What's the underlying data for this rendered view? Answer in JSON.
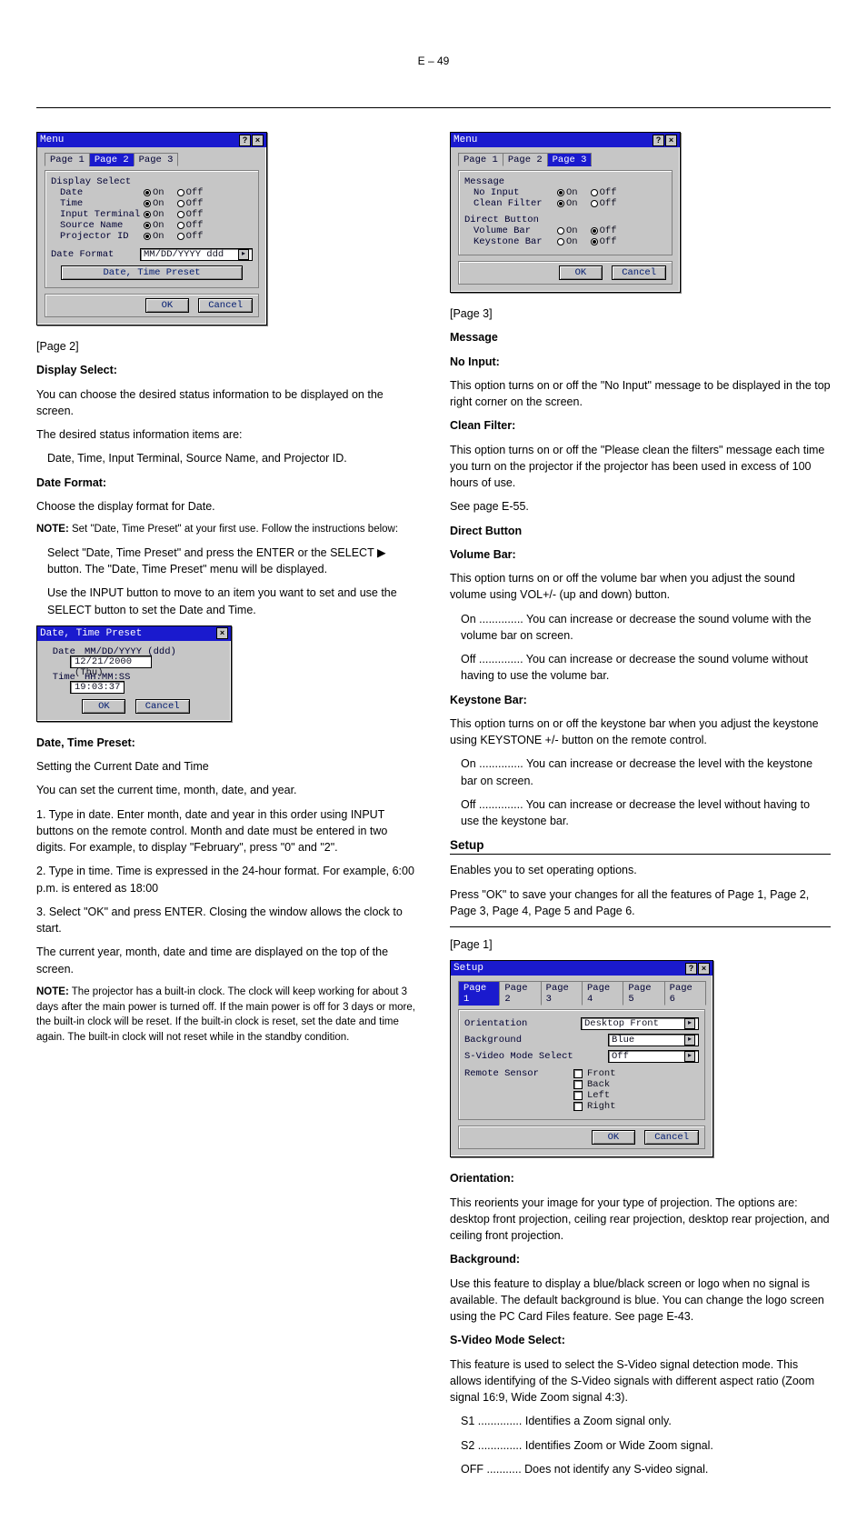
{
  "page_number": "E – 49",
  "menu_page2": {
    "title": "Menu",
    "tabs": [
      "Page 1",
      "Page 2",
      "Page 3"
    ],
    "active_tab": "Page 2",
    "group_label": "Display Select",
    "items": [
      {
        "label": "Date",
        "on": "On",
        "off": "Off",
        "sel": "on"
      },
      {
        "label": "Time",
        "on": "On",
        "off": "Off",
        "sel": "on"
      },
      {
        "label": "Input Terminal",
        "on": "On",
        "off": "Off",
        "sel": "on"
      },
      {
        "label": "Source Name",
        "on": "On",
        "off": "Off",
        "sel": "on"
      },
      {
        "label": "Projector ID",
        "on": "On",
        "off": "Off",
        "sel": "on"
      }
    ],
    "date_format_label": "Date Format",
    "date_format_value": "MM/DD/YYYY ddd",
    "btn_datetime": "Date, Time Preset",
    "ok": "OK",
    "cancel": "Cancel"
  },
  "menu_page3": {
    "title": "Menu",
    "tabs": [
      "Page 1",
      "Page 2",
      "Page 3"
    ],
    "active_tab": "Page 3",
    "group1": "Message",
    "items1": [
      {
        "label": "No Input",
        "on": "On",
        "off": "Off",
        "sel": "on"
      },
      {
        "label": "Clean Filter",
        "on": "On",
        "off": "Off",
        "sel": "on"
      }
    ],
    "group2": "Direct Button",
    "items2": [
      {
        "label": "Volume Bar",
        "on": "On",
        "off": "Off",
        "sel": "off"
      },
      {
        "label": "Keystone Bar",
        "on": "On",
        "off": "Off",
        "sel": "off"
      }
    ],
    "ok": "OK",
    "cancel": "Cancel"
  },
  "dtp": {
    "title": "Date, Time Preset",
    "date_lbl": "Date",
    "date_hint": "MM/DD/YYYY (ddd)",
    "date_value": "12/21/2000 (Thu)",
    "time_lbl": "Time",
    "time_hint": "HH:MM:SS",
    "time_value": "19:03:37",
    "ok": "OK",
    "cancel": "Cancel"
  },
  "setup": {
    "title": "Setup",
    "tabs": [
      "Page 1",
      "Page 2",
      "Page 3",
      "Page 4",
      "Page 5",
      "Page 6"
    ],
    "active_tab": "Page 1",
    "rows": {
      "orientation_label": "Orientation",
      "orientation_value": "Desktop Front",
      "background_label": "Background",
      "background_value": "Blue",
      "svideo_label": "S-Video Mode Select",
      "svideo_value": "Off",
      "remote_label": "Remote Sensor",
      "remote_opts": [
        "Front",
        "Back",
        "Left",
        "Right"
      ]
    },
    "ok": "OK",
    "cancel": "Cancel"
  },
  "text": {
    "menu2_h": "[Page 2]",
    "ds_head": "Display Select:",
    "ds_body": "You can choose the desired status information to be displayed on the screen.",
    "ds_items_head": "The desired status information items are:",
    "ds_items": "Date, Time, Input Terminal, Source Name, and Projector ID.",
    "df_head": "Date Format:",
    "df_body": "Choose the display format for Date.",
    "df_note_lbl": "NOTE:",
    "df_note": "Set \"Date, Time Preset\" at your first use. Follow the instructions below:",
    "df_steps": [
      "Select \"Date, Time Preset\" and press the ENTER or the SELECT ▶ button. The \"Date, Time Preset\" menu will be displayed.",
      "Use the INPUT button to move to an item you want to set and use the SELECT button to set the Date and Time."
    ],
    "dtp_head": "Date, Time Preset:",
    "dtp_body": "Setting the Current Date and Time",
    "dtp_text1": "You can set the current time, month, date, and year.",
    "dtp_steps": [
      "1. Type in date.  Enter month, date and year in this order using INPUT buttons on the remote control. Month and date must be entered in two digits. For example, to display \"February\", press \"0\" and \"2\".",
      "2. Type in time.  Time is expressed in the 24-hour format. For example, 6:00 p.m. is entered as 18:00",
      "3. Select \"OK\" and press ENTER.  Closing the window allows the clock to start."
    ],
    "dtp_tail": "The current year, month, date and time are displayed on the top of the screen.",
    "dtp_note_lbl": "NOTE:",
    "dtp_note": "The projector has a built-in clock. The clock will keep working for about 3 days after the main power is turned off. If the main power is off for 3 days or more, the built-in clock will be reset. If the built-in clock is reset, set the date and time again. The built-in clock will not reset while in the standby condition.",
    "menu3_h": "[Page 3]",
    "msg_head": "Message",
    "noinput_head": "No Input:",
    "noinput_body": "This option turns on or off the \"No Input\" message to be displayed in the top right corner on the screen.",
    "cf_head": "Clean Filter:",
    "cf_body": "This option turns on or off the \"Please clean the filters\" message each time you turn on the projector if the projector has been used in excess of 100 hours of use.",
    "cf_tail": "See page E-55.",
    "db_head": "Direct Button",
    "vb_head": "Volume Bar:",
    "vb_body": "This option turns on or off the volume bar when you adjust the sound volume using VOL+/- (up and down) button.",
    "vb_on": "On .............. You can increase or decrease the sound volume with the volume bar on screen.",
    "vb_off": "Off .............. You can increase or decrease the sound volume without having to use the volume bar.",
    "kb_head": "Keystone Bar:",
    "kb_body": "This option turns on or off the keystone bar when you adjust the keystone using KEYSTONE +/- button on the remote control.",
    "kb_on": "On .............. You can increase or decrease the level with the keystone bar on screen.",
    "kb_off": "Off .............. You can increase or decrease the level without having to use the keystone bar.",
    "setup_head": "Setup",
    "setup_lead": "Enables you to set operating options.",
    "setup_ok_note": "Press \"OK\" to save your changes for all the features of Page 1, Page 2, Page 3, Page 4, Page 5 and Page 6.",
    "p1_h": "[Page 1]",
    "orient_head": "Orientation:",
    "orient_body": "This reorients your image for your type of projection. The options are: desktop front projection, ceiling rear projection, desktop rear projection, and ceiling front projection.",
    "bg_head": "Background:",
    "bg_body": "Use this feature to display a blue/black screen or logo when no signal is available. The default background is blue. You can change the logo screen using the PC Card Files feature. See page E-43.",
    "svideo_head": "S-Video Mode Select:",
    "svideo_body": "This feature is used to select the S-Video signal detection mode. This allows identifying of the S-Video signals with different aspect ratio (Zoom signal 16:9, Wide Zoom signal 4:3).",
    "svideo_s1": "S1 .............. Identifies a Zoom signal only.",
    "svideo_s2": "S2 .............. Identifies Zoom or Wide Zoom signal.",
    "svideo_off": "OFF ........... Does not identify any S-video signal."
  }
}
